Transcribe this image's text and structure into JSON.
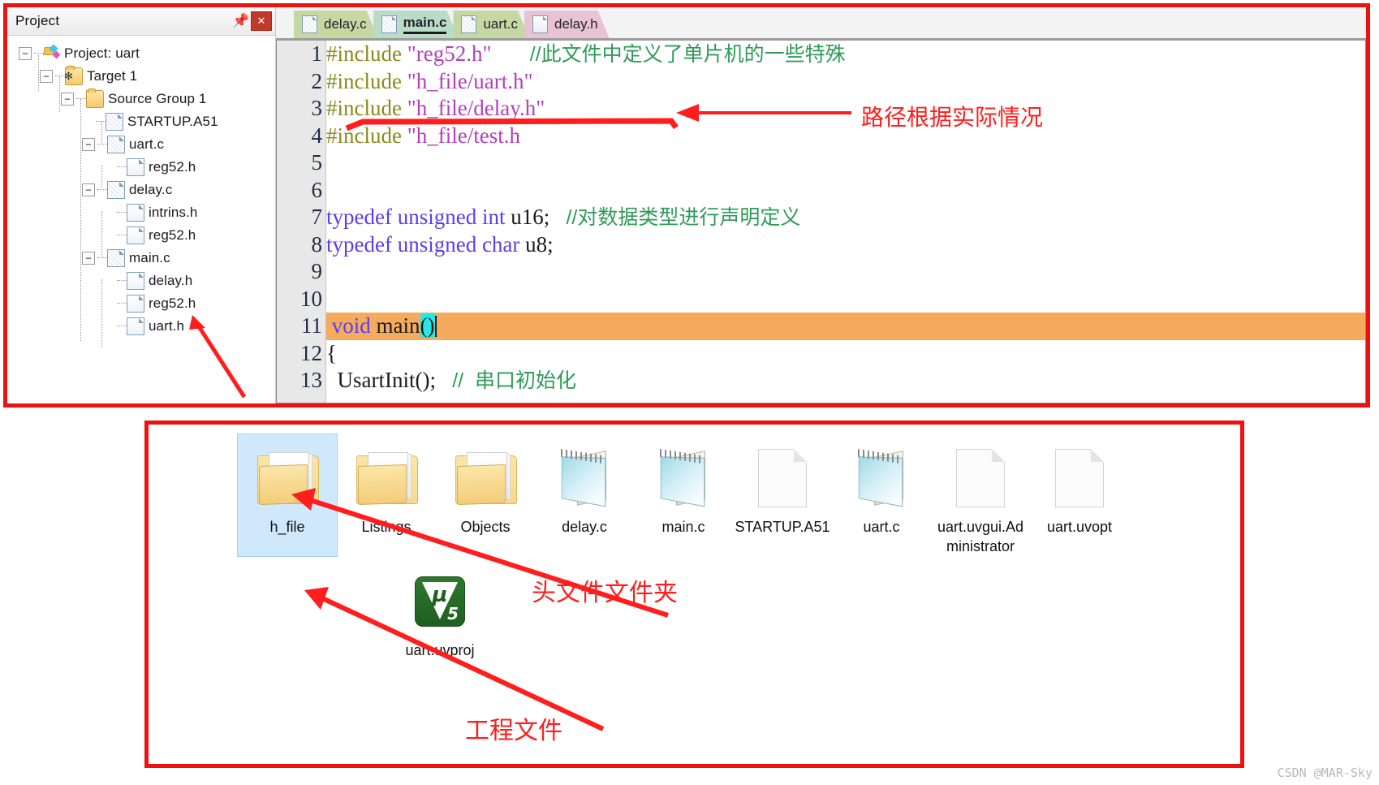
{
  "project_pane": {
    "title": "Project",
    "pin_icon": "pin-icon",
    "close_icon": "close-icon",
    "tree": [
      {
        "label": "Project: uart",
        "depth": 0,
        "icon": "project-icon",
        "expander": "-"
      },
      {
        "label": "Target 1",
        "depth": 1,
        "icon": "target-folder-icon",
        "expander": "-"
      },
      {
        "label": "Source Group 1",
        "depth": 2,
        "icon": "folder-icon",
        "expander": "-"
      },
      {
        "label": "STARTUP.A51",
        "depth": 3,
        "icon": "source-file-icon",
        "expander": ""
      },
      {
        "label": "uart.c",
        "depth": 3,
        "icon": "source-file-icon",
        "expander": "-"
      },
      {
        "label": "reg52.h",
        "depth": 4,
        "icon": "header-file-icon",
        "expander": ""
      },
      {
        "label": "delay.c",
        "depth": 3,
        "icon": "source-file-icon",
        "expander": "-"
      },
      {
        "label": "intrins.h",
        "depth": 4,
        "icon": "header-file-icon",
        "expander": ""
      },
      {
        "label": "reg52.h",
        "depth": 4,
        "icon": "header-file-icon",
        "expander": ""
      },
      {
        "label": "main.c",
        "depth": 3,
        "icon": "source-file-icon",
        "expander": "-"
      },
      {
        "label": "delay.h",
        "depth": 4,
        "icon": "header-file-icon",
        "expander": ""
      },
      {
        "label": "reg52.h",
        "depth": 4,
        "icon": "header-file-icon",
        "expander": ""
      },
      {
        "label": "uart.h",
        "depth": 4,
        "icon": "header-file-icon",
        "expander": ""
      }
    ]
  },
  "editor": {
    "tabs": [
      {
        "label": "delay.c",
        "active": false,
        "style": "green"
      },
      {
        "label": "main.c",
        "active": true,
        "style": "active"
      },
      {
        "label": "uart.c",
        "active": false,
        "style": "green"
      },
      {
        "label": "delay.h",
        "active": false,
        "style": "pink"
      }
    ],
    "line_numbers": [
      "1",
      "2",
      "3",
      "4",
      "5",
      "6",
      "7",
      "8",
      "9",
      "10",
      "11",
      "12",
      "13"
    ],
    "lines": [
      {
        "n": "1",
        "pre": "#include",
        "str": "\"reg52.h\"",
        "comment": "//此文件中定义了单片机的一些特殊"
      },
      {
        "n": "2",
        "pre": "#include",
        "str": "\"h_file/uart.h\"",
        "comment": ""
      },
      {
        "n": "3",
        "pre": "#include",
        "str": "\"h_file/delay.h\"",
        "comment": ""
      },
      {
        "n": "4",
        "pre": "#include",
        "str": "\"h_file/test.h",
        "comment": ""
      },
      {
        "n": "5",
        "text": ""
      },
      {
        "n": "6",
        "text": ""
      },
      {
        "n": "7",
        "kw": "typedef unsigned int",
        "plain": " u16;",
        "comment": "//对数据类型进行声明定义"
      },
      {
        "n": "8",
        "kw": "typedef unsigned char",
        "plain": " u8;",
        "comment": ""
      },
      {
        "n": "9",
        "text": ""
      },
      {
        "n": "10",
        "text": ""
      },
      {
        "n": "11",
        "kw": "void",
        "plain": " main",
        "braces": "()",
        "highlighted": true
      },
      {
        "n": "12",
        "plain": "{"
      },
      {
        "n": "13",
        "plain": "  UsartInit();",
        "comment": "//  串口初始化"
      }
    ]
  },
  "annotations": {
    "path_note": "路径根据实际情况",
    "header_folder_note": "头文件文件夹",
    "project_file_note": "工程文件"
  },
  "explorer": {
    "items": [
      {
        "name": "h_file",
        "icon": "folder-icon",
        "selected": true
      },
      {
        "name": "Listings",
        "icon": "folder-icon",
        "selected": false
      },
      {
        "name": "Objects",
        "icon": "folder-icon",
        "selected": false
      },
      {
        "name": "delay.c",
        "icon": "notepad-icon",
        "selected": false
      },
      {
        "name": "main.c",
        "icon": "notepad-icon",
        "selected": false
      },
      {
        "name": "STARTUP.A51",
        "icon": "blank-document-icon",
        "selected": false
      },
      {
        "name": "uart.c",
        "icon": "notepad-icon",
        "selected": false
      },
      {
        "name": "uart.uvgui.Administrator",
        "icon": "blank-document-icon",
        "selected": false
      },
      {
        "name": "uart.uvopt",
        "icon": "blank-document-icon",
        "selected": false
      }
    ],
    "project_file": {
      "name": "uart.uvproj",
      "icon": "uvision5-icon"
    }
  },
  "watermark": "CSDN @MAR-Sky",
  "colors": {
    "annotation_red": "#ff1d1d",
    "border_red": "#ee1111",
    "highlight_orange": "#f5ab5e",
    "brace_cyan": "#28e6e6",
    "selection_blue": "#cfe8fb",
    "comment_green": "#2e9b57",
    "string_purple": "#b23fbe",
    "keyword_blue": "#5a3df0",
    "preprocessor_olive": "#8a8a1d"
  }
}
